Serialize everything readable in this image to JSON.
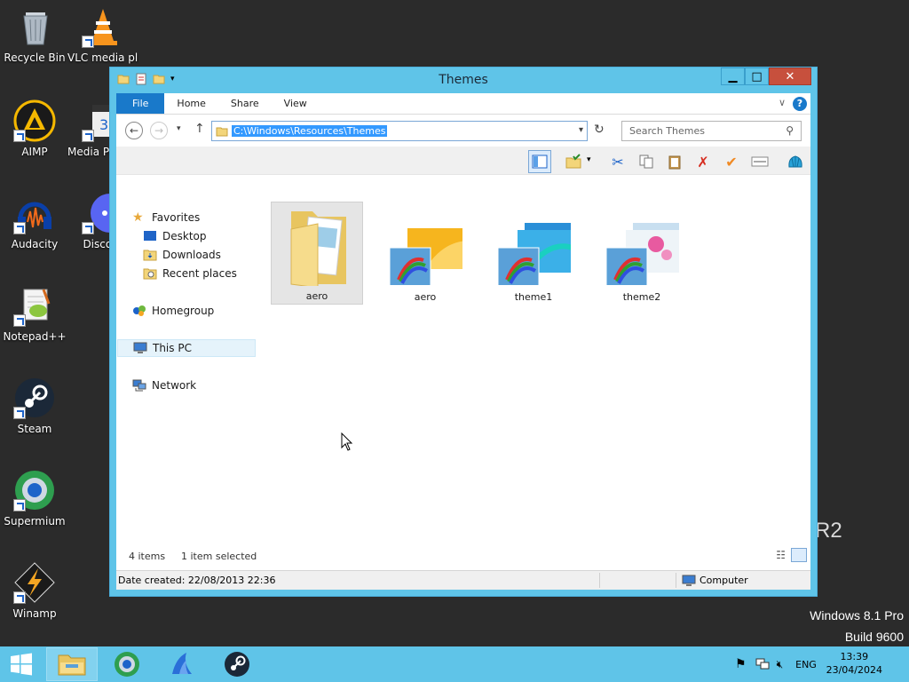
{
  "desktop": {
    "icons": [
      {
        "label": "Recycle Bin"
      },
      {
        "label": "VLC media player"
      },
      {
        "label": "AIMP"
      },
      {
        "label": "Media Player Classic"
      },
      {
        "label": "Audacity"
      },
      {
        "label": "Discord"
      },
      {
        "label": "Notepad++"
      },
      {
        "label": "Steam"
      },
      {
        "label": "Supermium"
      },
      {
        "label": "Winamp"
      }
    ],
    "watermark_line1": "Windows 8.1 Pro",
    "watermark_line2": "Build 9600",
    "watermark_partial": "R2"
  },
  "window": {
    "title": "Themes",
    "tabs": {
      "file": "File",
      "home": "Home",
      "share": "Share",
      "view": "View"
    },
    "address": "C:\\Windows\\Resources\\Themes",
    "search_placeholder": "Search Themes",
    "nav": {
      "favorites": "Favorites",
      "desktop": "Desktop",
      "downloads": "Downloads",
      "recent": "Recent places",
      "homegroup": "Homegroup",
      "this_pc": "This PC",
      "network": "Network"
    },
    "items": [
      {
        "label": "aero",
        "type": "folder"
      },
      {
        "label": "aero",
        "type": "theme"
      },
      {
        "label": "theme1",
        "type": "theme"
      },
      {
        "label": "theme2",
        "type": "theme"
      }
    ],
    "status": {
      "count": "4 items",
      "selected": "1 item selected",
      "date_created": "Date created: 22/08/2013 22:36",
      "location": "Computer"
    }
  },
  "taskbar": {
    "lang": "ENG",
    "time": "13:39",
    "date": "23/04/2024"
  },
  "colors": {
    "window_frame": "#5fc4e8",
    "file_tab": "#1979ca",
    "close_button": "#c7503d",
    "selection": "#3399ff"
  }
}
